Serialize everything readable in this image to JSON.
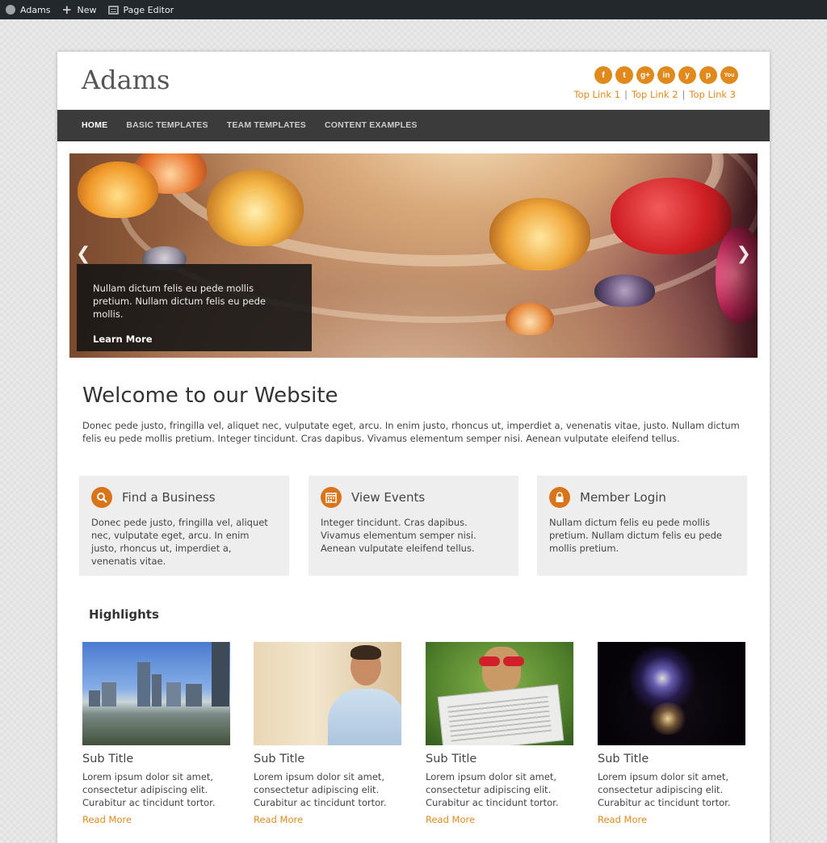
{
  "adminbar": {
    "site_label": "Adams",
    "new_label": "New",
    "editor_label": "Page Editor",
    "icons": [
      "dashboard-icon",
      "plus-icon",
      "page-editor-icon"
    ]
  },
  "header": {
    "site_title": "Adams",
    "social": [
      {
        "name": "facebook",
        "glyph": "f"
      },
      {
        "name": "twitter",
        "glyph": "t"
      },
      {
        "name": "google-plus",
        "glyph": "g+"
      },
      {
        "name": "linkedin",
        "glyph": "in"
      },
      {
        "name": "yelp",
        "glyph": "y"
      },
      {
        "name": "pinterest",
        "glyph": "p"
      },
      {
        "name": "youtube",
        "glyph": "You"
      }
    ],
    "top_links": [
      "Top Link 1",
      "Top Link 2",
      "Top Link 3"
    ],
    "separator": "|"
  },
  "nav": {
    "items": [
      "HOME",
      "BASIC TEMPLATES",
      "TEAM TEMPLATES",
      "CONTENT EXAMPLES"
    ],
    "active": "HOME"
  },
  "hero": {
    "caption": "Nullam dictum felis eu pede mollis pretium. Nullam dictum felis eu pede mollis.",
    "link": "Learn More",
    "prev_glyph": "❮",
    "next_glyph": "❯"
  },
  "welcome": {
    "title": "Welcome to our Website",
    "text": "Donec pede justo, fringilla vel, aliquet nec, vulputate eget, arcu. In enim justo, rhoncus ut, imperdiet a, venenatis vitae, justo. Nullam dictum felis eu pede mollis pretium. Integer tincidunt. Cras dapibus. Vivamus elementum semper nisi. Aenean vulputate eleifend tellus."
  },
  "features": [
    {
      "icon": "search-icon",
      "glyph": "⚲",
      "title": "Find a Business",
      "text": "Donec pede justo, fringilla vel, aliquet nec, vulputate eget, arcu. In enim justo, rhoncus ut, imperdiet a, venenatis vitae."
    },
    {
      "icon": "calendar-icon",
      "glyph": "▦",
      "title": "View Events",
      "text": "Integer tincidunt. Cras dapibus. Vivamus elementum semper nisi. Aenean vulputate eleifend tellus."
    },
    {
      "icon": "lock-icon",
      "glyph": "🔒",
      "title": "Member Login",
      "text": "Nullam dictum felis eu pede mollis pretium. Nullam dictum felis eu pede mollis pretium."
    }
  ],
  "highlights": {
    "title": "Highlights",
    "cards": [
      {
        "image": "city-skyline-image",
        "title": "Sub Title",
        "text": "Lorem ipsum dolor sit amet, consectetur adipiscing elit. Curabitur ac tincidunt tortor.",
        "link": "Read More"
      },
      {
        "image": "smiling-man-image",
        "title": "Sub Title",
        "text": "Lorem ipsum dolor sit amet, consectetur adipiscing elit. Curabitur ac tincidunt tortor.",
        "link": "Read More"
      },
      {
        "image": "dog-newspaper-image",
        "title": "Sub Title",
        "text": "Lorem ipsum dolor sit amet, consectetur adipiscing elit. Curabitur ac tincidunt tortor.",
        "link": "Read More"
      },
      {
        "image": "fireworks-image",
        "title": "Sub Title",
        "text": "Lorem ipsum dolor sit amet, consectetur adipiscing elit. Curabitur ac tincidunt tortor.",
        "link": "Read More"
      }
    ]
  },
  "colors": {
    "accent": "#e08a1e",
    "icon_circle": "#d9741a",
    "nav_bg": "#3b3b3b",
    "admin_bg": "#23282d"
  }
}
